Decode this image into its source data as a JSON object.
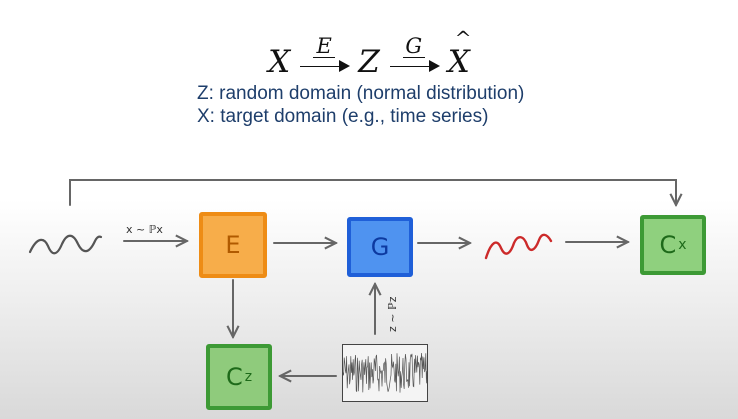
{
  "formula": {
    "input": "X",
    "encoder": "E",
    "latent": "Z",
    "generator": "G",
    "output": "X"
  },
  "description": {
    "z_line": "Z: random domain (normal distribution)",
    "x_line": "X: target domain (e.g., time series)"
  },
  "nodes": {
    "encoder": "E",
    "generator": "G",
    "critic_x": {
      "main": "C",
      "sub": "x"
    },
    "critic_z": {
      "main": "C",
      "sub": "z"
    }
  },
  "labels": {
    "x_sample": "x ~ ℙx",
    "z_sample": "z ~ ℙz"
  },
  "colors": {
    "encoder": "#f7ad4a",
    "generator": "#4f93f0",
    "critic": "#8fd07e",
    "signal_output": "#cc2a2a",
    "description_text": "#1e3e6b"
  }
}
